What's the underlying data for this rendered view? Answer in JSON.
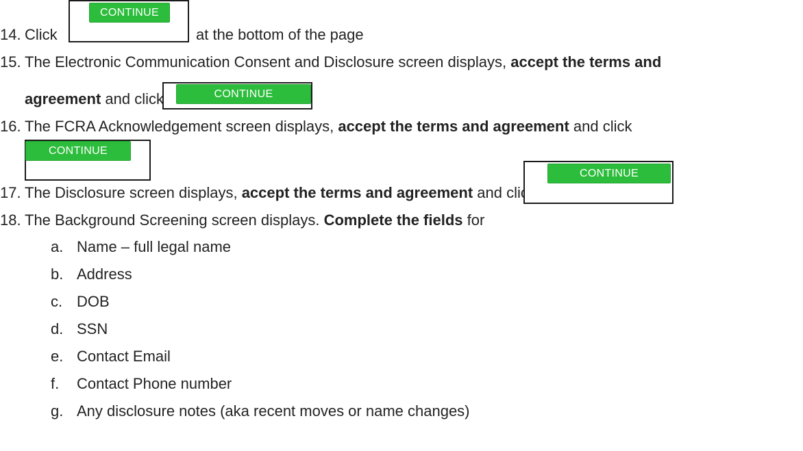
{
  "button_label": "CONTINUE",
  "steps": {
    "s14": {
      "num": "14.",
      "pre": "Click",
      "post": "at the bottom of the page"
    },
    "s15": {
      "num": "15.",
      "text": "The Electronic Communication Consent and Disclosure screen displays, ",
      "bold": "accept the terms and",
      "bold2": "agreement",
      "post": " and click"
    },
    "s16": {
      "num": "16.",
      "text": "The FCRA Acknowledgement screen displays, ",
      "bold": "accept the terms and agreement",
      "post": " and click"
    },
    "s17": {
      "num": "17.",
      "text": "The Disclosure screen displays, ",
      "bold": "accept the terms and agreement",
      "post": " and click"
    },
    "s18": {
      "num": "18.",
      "text": "The Background Screening screen displays. ",
      "bold": "Complete the fields",
      "post": " for"
    }
  },
  "fields": [
    {
      "letter": "a.",
      "text": "Name – full legal name"
    },
    {
      "letter": "b.",
      "text": "Address"
    },
    {
      "letter": "c.",
      "text": "DOB"
    },
    {
      "letter": "d.",
      "text": "SSN"
    },
    {
      "letter": "e.",
      "text": "Contact Email"
    },
    {
      "letter": "f.",
      "text": "Contact Phone number"
    },
    {
      "letter": "g.",
      "text": "Any disclosure notes (aka recent moves or name changes)"
    }
  ]
}
